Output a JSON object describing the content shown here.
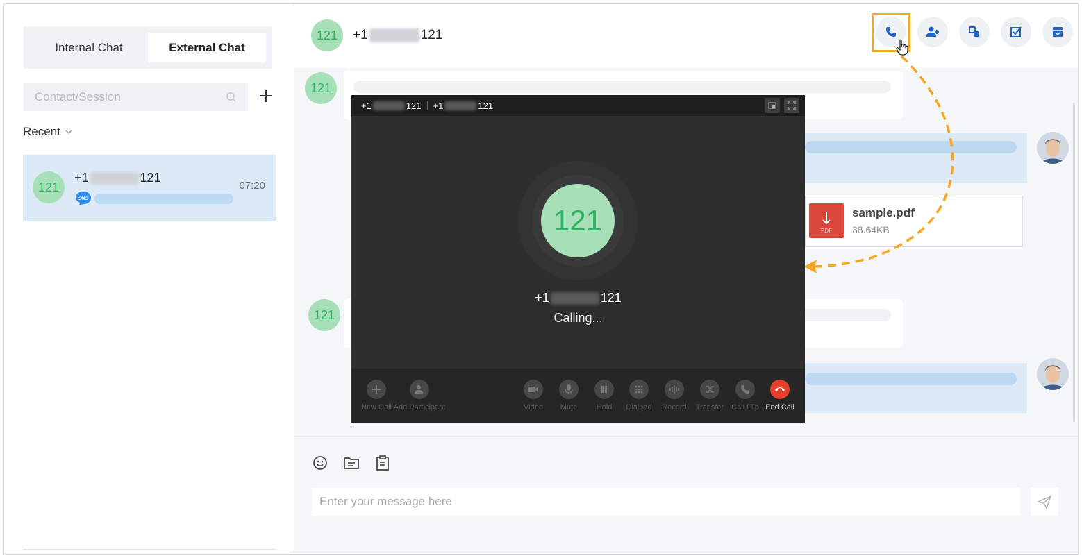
{
  "sidebar": {
    "tabs": [
      {
        "label": "Internal Chat",
        "active": false
      },
      {
        "label": "External Chat",
        "active": true
      }
    ],
    "search_placeholder": "Contact/Session",
    "recent_label": "Recent",
    "sessions": [
      {
        "avatar": "121",
        "name_prefix": "+1",
        "name_suffix": "121",
        "time": "07:20",
        "channel_icon": "sms-icon",
        "channel_label": "SMS"
      }
    ]
  },
  "header": {
    "avatar": "121",
    "title_prefix": "+1",
    "title_suffix": "121",
    "actions": [
      "phone-icon",
      "add-contact-icon",
      "transfer-icon",
      "checklist-icon",
      "archive-icon"
    ]
  },
  "messages": {
    "incoming_avatar": "121",
    "file": {
      "name": "sample.pdf",
      "size": "38.64KB",
      "icon_label": "PDF"
    }
  },
  "call": {
    "tab1_prefix": "+1",
    "tab1_suffix": "121",
    "tab2_prefix": "+1",
    "tab2_suffix": "121",
    "avatar": "121",
    "number_prefix": "+1",
    "number_suffix": "121",
    "status": "Calling...",
    "controls": [
      {
        "label": "New Call",
        "icon": "plus-icon"
      },
      {
        "label": "Add Participant",
        "icon": "add-participant-icon"
      },
      {
        "label": "Video",
        "icon": "video-icon"
      },
      {
        "label": "Mute",
        "icon": "mic-icon"
      },
      {
        "label": "Hold",
        "icon": "pause-icon"
      },
      {
        "label": "Dialpad",
        "icon": "dialpad-icon"
      },
      {
        "label": "Record",
        "icon": "record-icon"
      },
      {
        "label": "Transfer",
        "icon": "transfer-icon"
      },
      {
        "label": "Call Flip",
        "icon": "call-flip-icon"
      },
      {
        "label": "End Call",
        "icon": "end-call-icon"
      }
    ]
  },
  "composer": {
    "placeholder": "Enter your message here",
    "tools": [
      "emoji-icon",
      "file-icon",
      "template-icon"
    ]
  },
  "colors": {
    "highlight": "#f5a623",
    "avatar_bg": "#a7dfb9",
    "avatar_text": "#2bb35e",
    "end_call": "#e8402f",
    "selected_session": "#dceaf7"
  }
}
